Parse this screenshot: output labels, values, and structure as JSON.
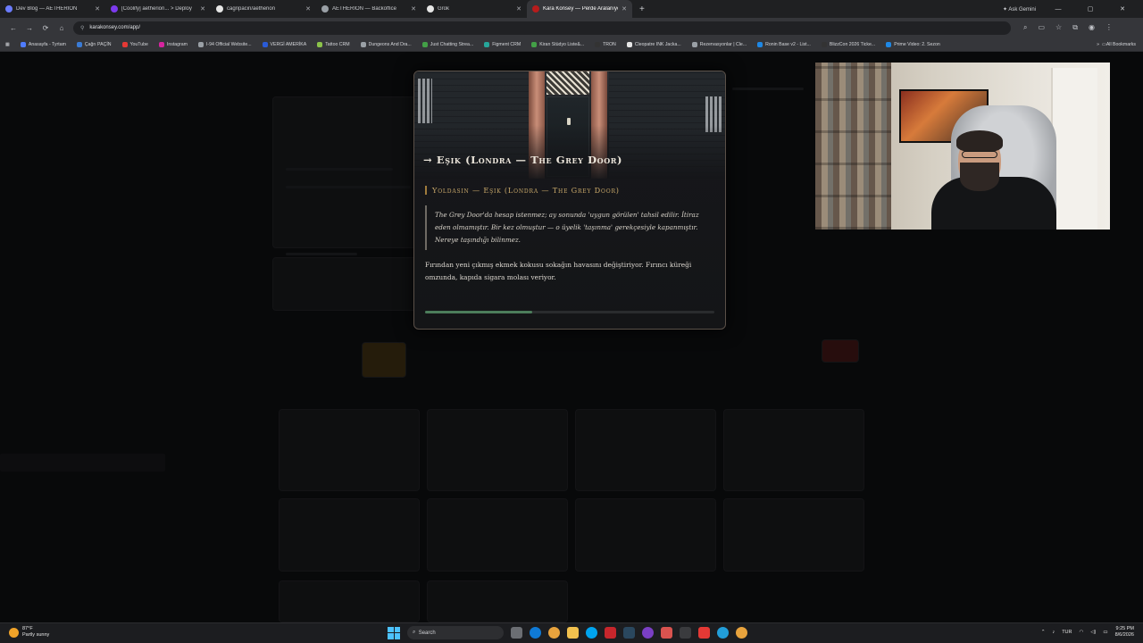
{
  "browser": {
    "tabs": [
      {
        "title": "Dev Blog — AETHERION",
        "color": "#6b7cff",
        "active": false
      },
      {
        "title": "[Coolify] aetherion... > Deploy",
        "color": "#7c3aed",
        "active": false
      },
      {
        "title": "cagripacin/aetherion",
        "color": "#e6e6e6",
        "active": false
      },
      {
        "title": "AETHERION — Backoffice",
        "color": "#9aa0a6",
        "active": false
      },
      {
        "title": "Grok",
        "color": "#e6e6e6",
        "active": false
      },
      {
        "title": "Kara Konsey — Perde Aralanıyor",
        "color": "#b71c1c",
        "active": true
      }
    ],
    "new_tab": "+",
    "ask_gemini": "Ask Gemini",
    "window_controls": [
      "—",
      "▢",
      "✕"
    ],
    "url": "karakonsey.com/app/",
    "bookmarks": [
      {
        "label": "Anasayfa - Tyrtam",
        "color": "#4f7cff"
      },
      {
        "label": "Çağrı PAÇİN",
        "color": "#3a7bd5"
      },
      {
        "label": "YouTube",
        "color": "#e53935"
      },
      {
        "label": "Instagram",
        "color": "#d6249f"
      },
      {
        "label": "I-94 Official Website...",
        "color": "#9aa0a6"
      },
      {
        "label": "VERGİ AMERİKA",
        "color": "#2a5bd7"
      },
      {
        "label": "Tattoo CRM",
        "color": "#8bc34a"
      },
      {
        "label": "Dungeons And Dra...",
        "color": "#9aa0a6"
      },
      {
        "label": "Just Chatting Strea...",
        "color": "#43a047"
      },
      {
        "label": "Figment CRM",
        "color": "#26a69a"
      },
      {
        "label": "Kiran Stüdyo Liste&...",
        "color": "#43a047"
      },
      {
        "label": "TRON",
        "color": "#333333"
      },
      {
        "label": "Cleopatre INK Jacka...",
        "color": "#e6e6e6"
      },
      {
        "label": "Rezervasyonlar | Cle...",
        "color": "#9aa0a6"
      },
      {
        "label": "Ronin Base v2 - List...",
        "color": "#1e88e5"
      },
      {
        "label": "BlizzCon 2026 Ticke...",
        "color": "#333333"
      },
      {
        "label": "Prime Video: 2. Sezon",
        "color": "#1e88e5"
      }
    ],
    "all_bookmarks": "All Bookmarks"
  },
  "modal": {
    "title": "→ Eşik (Londra — The Grey Door)",
    "subtitle": "Yoldasın — Eşik (Londra — The Grey Door)",
    "quote": "The Grey Door'da hesap istenmez; ay sonunda 'uygun görülen' tahsil edilir. İtiraz eden olmamıştır. Bir kez olmuştur — o üyelik 'taşınma' gerekçesiyle kapanmıştır. Nereye taşındığı bilinmez.",
    "body": "Fırından yeni çıkmış ekmek kokusu sokağın havasını değiştiriyor. Fırıncı küreği omzunda, kapıda sigara molası veriyor.",
    "progress": 0.37
  },
  "taskbar": {
    "weather_temp": "87°F",
    "weather_desc": "Partly sunny",
    "search": "Search",
    "lang": "TUR",
    "time": "9:25 PM",
    "date": "8/6/2026"
  }
}
